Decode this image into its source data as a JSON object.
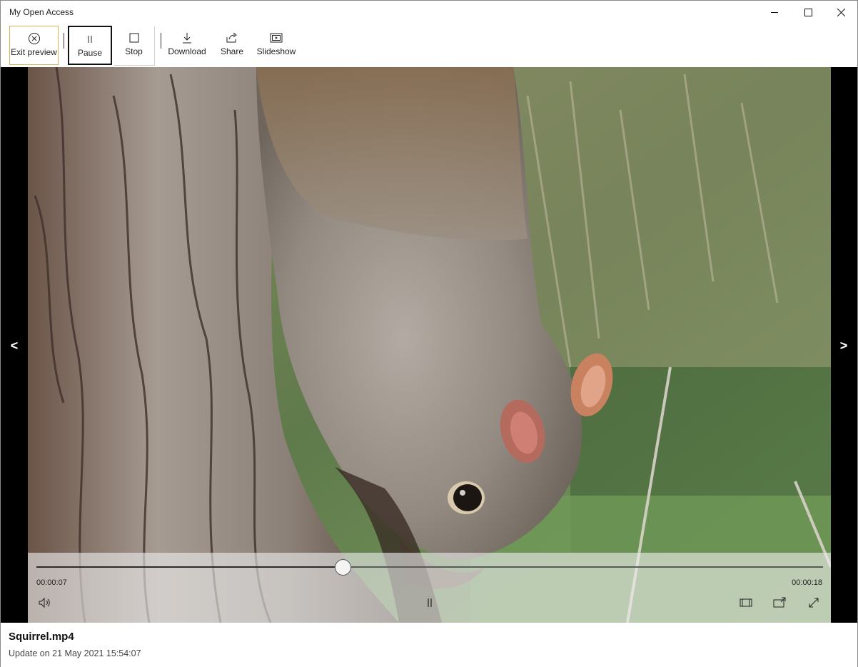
{
  "window": {
    "title": "My Open Access"
  },
  "toolbar": {
    "buttons": [
      {
        "label": "Exit preview",
        "icon": "close-circle-icon"
      },
      {
        "label": "Pause",
        "icon": "pause-icon"
      },
      {
        "label": "Stop",
        "icon": "stop-icon"
      },
      {
        "label": "Download",
        "icon": "download-icon"
      },
      {
        "label": "Share",
        "icon": "share-icon"
      },
      {
        "label": "Slideshow",
        "icon": "slideshow-icon"
      }
    ]
  },
  "viewer": {
    "prev_arrow": "<",
    "next_arrow": ">",
    "video_content": "squirrel hanging head-down on tree trunk",
    "player": {
      "current_time": "00:00:07",
      "total_time": "00:00:18",
      "progress_fraction": 0.39,
      "icons": [
        "volume-icon",
        "pause-icon",
        "fit-screen-icon",
        "cast-icon",
        "fullscreen-icon"
      ]
    }
  },
  "file": {
    "name": "Squirrel.mp4",
    "updated": "Update on 21 May 2021 15:54:07"
  },
  "colors": {
    "selection_border": "#d8b25a",
    "focus_border": "#111111",
    "background": "#ffffff"
  }
}
